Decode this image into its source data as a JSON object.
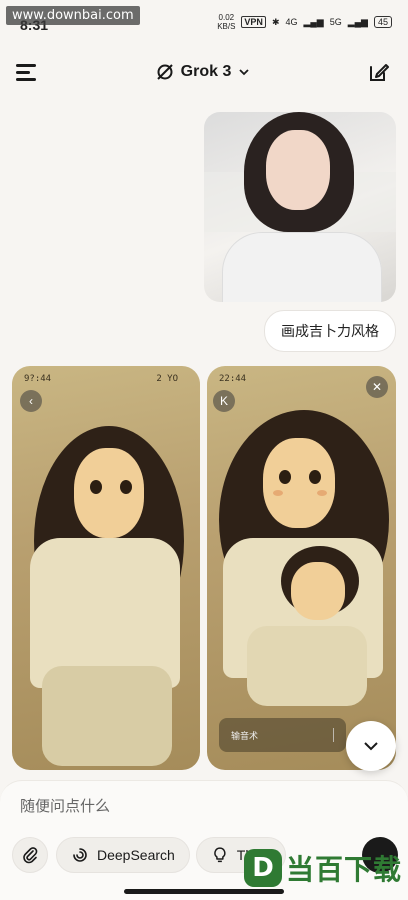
{
  "watermark": "www.downbai.com",
  "status_bar": {
    "time": "8:31",
    "net_speed": "0.02",
    "net_unit": "KB/S",
    "vpn": "VPN",
    "signal_4g": "4G",
    "signal_5g": "5G",
    "battery": "45"
  },
  "header": {
    "model_name": "Grok 3"
  },
  "chat": {
    "user_message": "画成吉卜力风格",
    "gen_left_top": "9?:44",
    "gen_left_top_right": "2 YO",
    "gen_right_top": "22:44",
    "gen_right_back": "K",
    "gen_right_bar_text": "输音术"
  },
  "composer": {
    "placeholder": "随便问点什么",
    "deepsearch_label": "DeepSearch",
    "think_label": "Think"
  },
  "brand": {
    "logo_letter": "D",
    "logo_text": "当百下载"
  },
  "colors": {
    "background": "#f7f5f2",
    "brand_green": "#2f7a33"
  }
}
